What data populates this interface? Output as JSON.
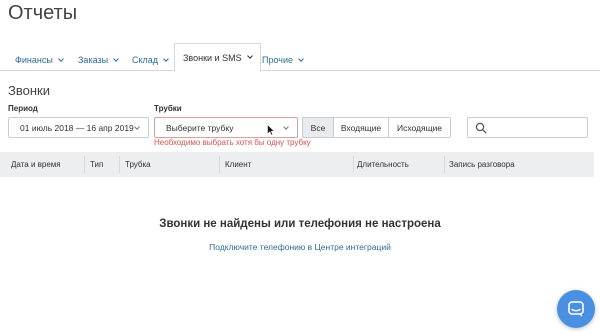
{
  "page_title": "Отчеты",
  "tabs": [
    {
      "label": "Финансы",
      "active": false
    },
    {
      "label": "Заказы",
      "active": false
    },
    {
      "label": "Склад",
      "active": false
    },
    {
      "label": "Звонки и SMS",
      "active": true
    },
    {
      "label": "Прочие",
      "active": false
    }
  ],
  "section_title": "Звонки",
  "filters": {
    "period_label": "Период",
    "period_value": "01 июль 2018 — 16 апр 2019",
    "handsets_label": "Трубки",
    "handsets_placeholder": "Выберите трубку",
    "handsets_error": "Необходимо выбрать хотя бы одну трубку",
    "call_type": {
      "options": [
        "Все",
        "Входящие",
        "Исходящие"
      ],
      "selected": "Все"
    },
    "search_placeholder": ""
  },
  "table": {
    "columns": [
      "Дата и время",
      "Тип",
      "Трубка",
      "Клиент",
      "Длительность",
      "Запись разговора"
    ]
  },
  "empty_state": {
    "title": "Звонки не найдены или телефония не настроена",
    "link": "Подключите телефонию в Центре интеграций"
  },
  "colors": {
    "link": "#2f6c9a",
    "error": "#d9534f",
    "header_bg": "#eceef0",
    "chat_button": "#4a90e2"
  },
  "icons": {
    "search": "search-icon",
    "chat": "chat-icon",
    "cursor": "mouse-pointer-icon"
  }
}
